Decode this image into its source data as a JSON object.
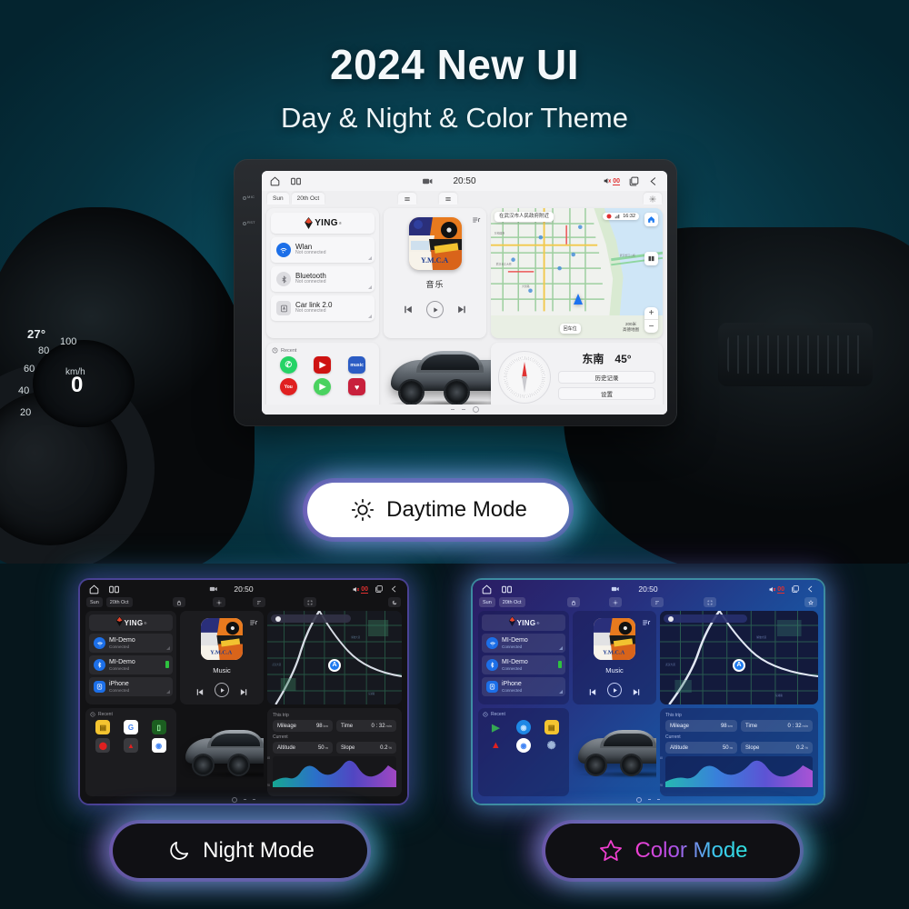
{
  "hero": {
    "title": "2024 New UI",
    "subtitle": "Day & Night & Color Theme"
  },
  "cluster": {
    "temperature": "27°",
    "speed_unit": "km/h",
    "speed_value": "0",
    "ticks": [
      "20",
      "40",
      "60",
      "80",
      "100"
    ]
  },
  "bezel": {
    "mic_label": "MIC",
    "reset_label": "RST"
  },
  "daytime": {
    "status": {
      "time": "20:50",
      "volume_level": "00"
    },
    "tabs": {
      "day": "Sun",
      "date": "20th Oct"
    },
    "brand": {
      "name": "YING",
      "registered": "®"
    },
    "connections": [
      {
        "icon": "wifi-icon",
        "name": "Wlan",
        "status": "Not connected"
      },
      {
        "icon": "bluetooth-icon",
        "name": "Bluetooth",
        "status": "Not connected"
      },
      {
        "icon": "carlink-icon",
        "name": "Car link 2.0",
        "status": "Not connected"
      }
    ],
    "music": {
      "label": "音乐"
    },
    "map": {
      "location": "在武汉市人民政府附近",
      "eta_time": "16:32",
      "zoom_in": "+",
      "zoom_out": "−",
      "scale": "200米",
      "scale_sub": "高德地图",
      "relocate": "回车位"
    },
    "recent": {
      "label": "Recent",
      "apps": [
        {
          "name": "whatsapp-app",
          "glyph": "✆",
          "color": "#25D366"
        },
        {
          "name": "youtube-app",
          "glyph": "▶",
          "color": "#CE1312"
        },
        {
          "name": "amazon-music-app",
          "glyph": "music",
          "color": "#2B5CC4"
        },
        {
          "name": "youtube-circle-app",
          "glyph": "▶",
          "color": "#E02020"
        },
        {
          "name": "green-player-app",
          "glyph": "▶",
          "color": "#4AD25F"
        },
        {
          "name": "iheart-radio-app",
          "glyph": "♥",
          "color": "#C8203C"
        }
      ]
    },
    "compass": {
      "direction": "东南",
      "degrees": "45°",
      "history_button": "历史记录",
      "settings_button": "设置"
    }
  },
  "night": {
    "status": {
      "time": "20:50",
      "volume_level": "00"
    },
    "tabs": {
      "day": "Sun",
      "date": "20th Oct"
    },
    "brand": {
      "name": "YING",
      "registered": "®"
    },
    "connections": [
      {
        "icon": "wifi-icon",
        "name": "MI-Demo",
        "status": "Connected"
      },
      {
        "icon": "bluetooth-icon",
        "name": "MI-Demo",
        "status": "Connected"
      },
      {
        "icon": "carlink-icon",
        "name": "iPhone",
        "status": "Connected"
      }
    ],
    "music": {
      "label": "Music"
    },
    "recent": {
      "label": "Recent",
      "apps": [
        {
          "name": "files-app",
          "glyph": "▤",
          "color": "#F4C430"
        },
        {
          "name": "google-app",
          "glyph": "G",
          "color": "#FFFFFF"
        },
        {
          "name": "phone-link-app",
          "glyph": "▯",
          "color": "#2E7D32"
        },
        {
          "name": "car-app",
          "glyph": "⬤",
          "color": "#E02020"
        },
        {
          "name": "navigation-app",
          "glyph": "▲",
          "color": "#E02020"
        },
        {
          "name": "chrome-app",
          "glyph": "◉",
          "color": "#4285F4"
        }
      ]
    },
    "trip": {
      "this_trip_label": "This trip",
      "current_label": "Current",
      "mileage_label": "Mileage",
      "mileage_value": "98",
      "mileage_unit": "km",
      "time_label": "Time",
      "time_value": "0 : 32",
      "time_unit": "min",
      "altitude_label": "Altitude",
      "altitude_value": "50",
      "altitude_unit": "m",
      "slope_label": "Slope",
      "slope_value": "0.2",
      "slope_unit": "%",
      "axis_max": "250",
      "axis_min": "120"
    }
  },
  "color": {
    "status": {
      "time": "20:50",
      "volume_level": "00"
    },
    "tabs": {
      "day": "Sun",
      "date": "20th Oct"
    },
    "brand": {
      "name": "YING",
      "registered": "®"
    },
    "connections": [
      {
        "icon": "wifi-icon",
        "name": "MI-Demo",
        "status": "Connected"
      },
      {
        "icon": "bluetooth-icon",
        "name": "MI-Demo",
        "status": "Connected"
      },
      {
        "icon": "carlink-icon",
        "name": "iPhone",
        "status": "Connected"
      }
    ],
    "music": {
      "label": "Music"
    },
    "recent": {
      "label": "Recent",
      "apps": [
        {
          "name": "play-store-app",
          "glyph": "▶",
          "color": "#34A853"
        },
        {
          "name": "photos-app",
          "glyph": "◉",
          "color": "#1E88E5"
        },
        {
          "name": "files-app",
          "glyph": "▤",
          "color": "#F4C430"
        },
        {
          "name": "navigation-app",
          "glyph": "▲",
          "color": "#E02020"
        },
        {
          "name": "chrome-app",
          "glyph": "◉",
          "color": "#4285F4"
        },
        {
          "name": "settings-app",
          "glyph": "✺",
          "color": "#90A4AE"
        }
      ]
    },
    "trip": {
      "this_trip_label": "This trip",
      "current_label": "Current",
      "mileage_label": "Mileage",
      "mileage_value": "98",
      "mileage_unit": "km",
      "time_label": "Time",
      "time_value": "0 : 32",
      "time_unit": "min",
      "altitude_label": "Altitude",
      "altitude_value": "50",
      "altitude_unit": "m",
      "slope_label": "Slope",
      "slope_value": "0.2",
      "slope_unit": "%",
      "axis_max": "250",
      "axis_min": "120"
    }
  },
  "pills": {
    "daytime": {
      "label": "Daytime Mode",
      "icon": "sun-icon"
    },
    "night": {
      "label": "Night Mode",
      "icon": "moon-icon"
    },
    "color": {
      "label": "Color Mode",
      "icon": "star-icon"
    }
  },
  "colors": {
    "accent_purple": "#A55AE6",
    "accent_cyan": "#3CD2E6",
    "accent_magenta": "#F03FD0",
    "brand_red": "#E8452B",
    "background_teal": "#0B5566"
  }
}
